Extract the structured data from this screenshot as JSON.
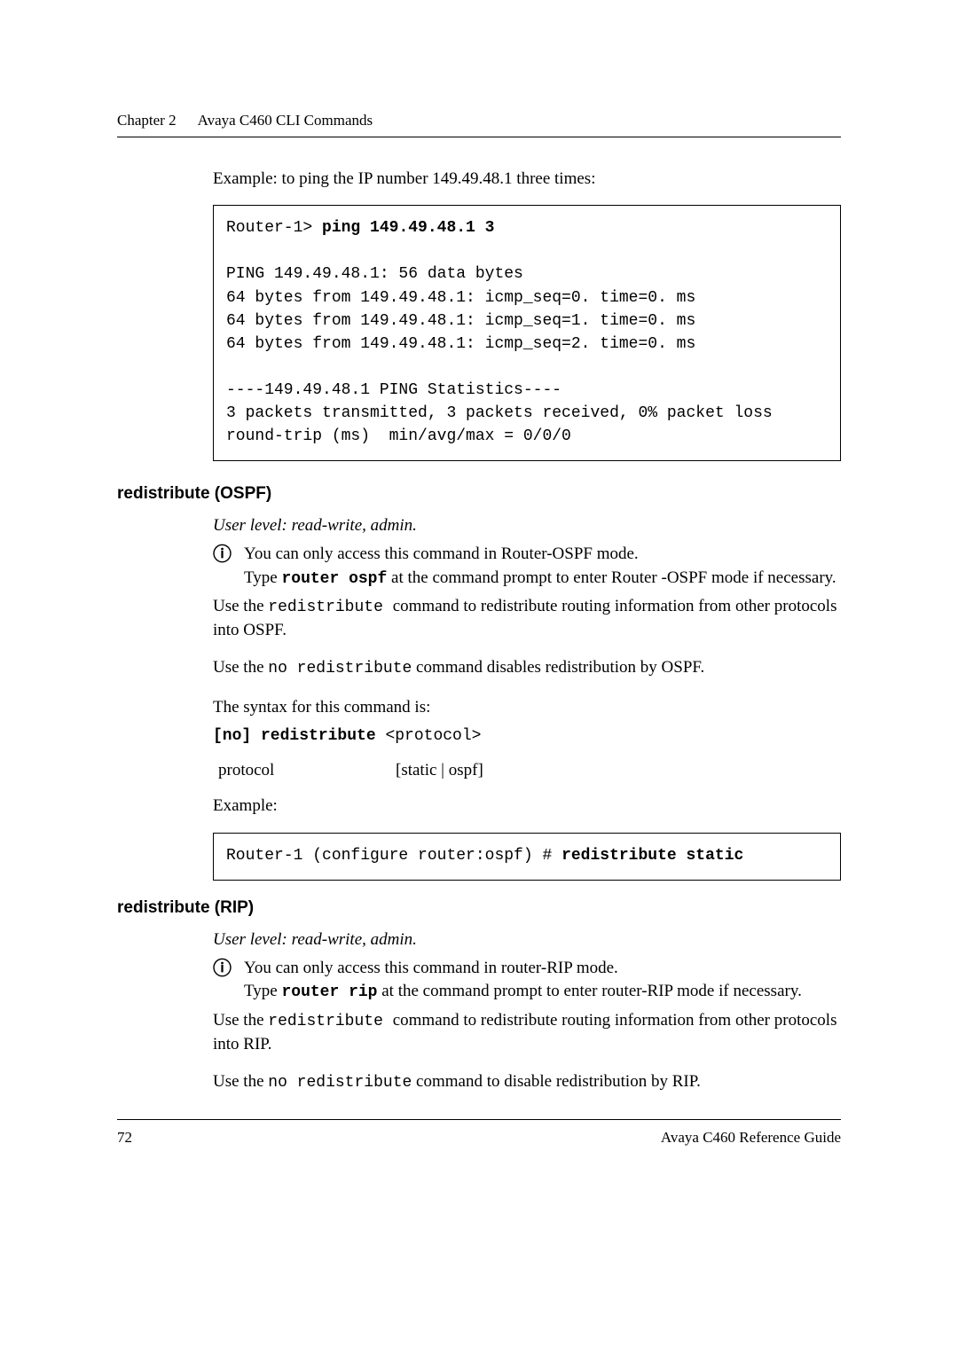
{
  "header": {
    "chapter": "Chapter 2",
    "title": "Avaya C460 CLI Commands"
  },
  "intro": {
    "text": "Example: to ping the IP number 149.49.48.1 three times:"
  },
  "code1": {
    "prompt": "Router-1> ",
    "cmd": "ping 149.49.48.1 3",
    "body": "PING 149.49.48.1: 56 data bytes\n64 bytes from 149.49.48.1: icmp_seq=0. time=0. ms\n64 bytes from 149.49.48.1: icmp_seq=1. time=0. ms\n64 bytes from 149.49.48.1: icmp_seq=2. time=0. ms\n\n----149.49.48.1 PING Statistics----\n3 packets transmitted, 3 packets received, 0% packet loss\nround-trip (ms)  min/avg/max = 0/0/0"
  },
  "ospf": {
    "heading": "redistribute (OSPF)",
    "userlevel": "User level: read-write, admin.",
    "note1a": "You can only access this command in Router-OSPF mode.",
    "note1b_pre": "Type ",
    "note1b_cmd": "router ospf",
    "note1b_post": " at the command prompt to enter Router -OSPF mode if necessary.",
    "para1_pre": "Use the ",
    "para1_mono": " redistribute ",
    "para1_post": " command to redistribute routing information from other protocols into OSPF.",
    "para2_pre": "Use the ",
    "para2_mono": "no redistribute",
    "para2_post": " command disables redistribution by OSPF.",
    "syntax_lead": "The syntax for this command is:",
    "syntax_bold": "[no] redistribute",
    "syntax_arg": " <protocol>",
    "param_name": "protocol",
    "param_val": "[static | ospf]",
    "example_label": "Example:",
    "code_prompt": "Router-1 (configure router:ospf) # ",
    "code_cmd": "redistribute static"
  },
  "rip": {
    "heading": "redistribute (RIP)",
    "userlevel": "User level: read-write, admin.",
    "note1a": "You can only access this command in router-RIP  mode.",
    "note1b_pre": "Type ",
    "note1b_cmd": "router rip",
    "note1b_post": " at the command prompt to enter router-RIP mode if necessary.",
    "para1_pre": "Use the ",
    "para1_mono": " redistribute ",
    "para1_post": " command to redistribute routing information from other protocols into RIP.",
    "para2_pre": "Use the ",
    "para2_mono": " no redistribute",
    "para2_post": " command to disable redistribution by RIP."
  },
  "footer": {
    "page": "72",
    "doc": "Avaya C460 Reference Guide"
  }
}
